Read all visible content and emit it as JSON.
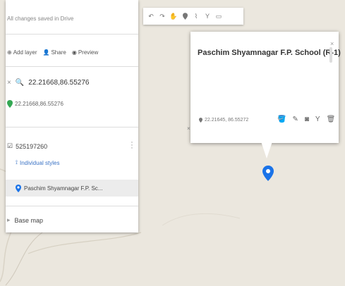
{
  "panel": {
    "save_status": "All changes saved in Drive",
    "actions": {
      "add_layer": "Add layer",
      "share": "Share",
      "preview": "Preview"
    },
    "search_query": "22.21668,86.55276",
    "search_result": "22.21668,86.55276",
    "layer_name": "525197260",
    "layer_style": "Individual styles",
    "layer_item": "Paschim Shyamnagar F.P. Sc...",
    "basemap_label": "Base map"
  },
  "toolbar": {
    "tools": [
      "undo-icon",
      "redo-icon",
      "hand-icon",
      "marker-icon",
      "line-icon",
      "directions-icon",
      "ruler-icon"
    ]
  },
  "infocard": {
    "title": "Paschim Shyamnagar F.P. School (R-1)",
    "coords": "22.21645, 86.55272"
  },
  "colors": {
    "pin": "#1a73e8",
    "result_pin": "#34a853",
    "link": "#3b73c5"
  }
}
